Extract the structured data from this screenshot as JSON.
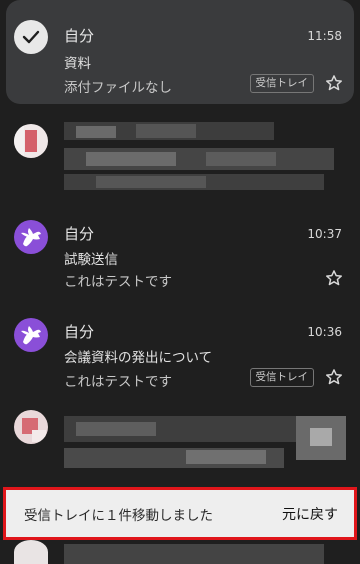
{
  "mails": [
    {
      "sender": "自分",
      "time": "11:58",
      "subject": "資料",
      "snippet": "添付ファイルなし",
      "label": "受信トレイ",
      "selected": true,
      "avatar": "check-icon"
    },
    {
      "sender": "自分",
      "time": "10:37",
      "subject": "試験送信",
      "snippet": "これはテストです",
      "avatar": "pegasus-icon"
    },
    {
      "sender": "自分",
      "time": "10:36",
      "subject": "会議資料の発出について",
      "snippet": "これはテストです",
      "label": "受信トレイ",
      "avatar": "pegasus-icon"
    }
  ],
  "snackbar": {
    "message": "受信トレイに１件移動しました",
    "action": "元に戻す"
  },
  "colors": {
    "background": "#1f1f1f",
    "selected_row": "#3a3b3d",
    "avatar_purple": "#8a4fd8",
    "snackbar_bg": "#eeeeee",
    "highlight_border": "#e0161b"
  }
}
